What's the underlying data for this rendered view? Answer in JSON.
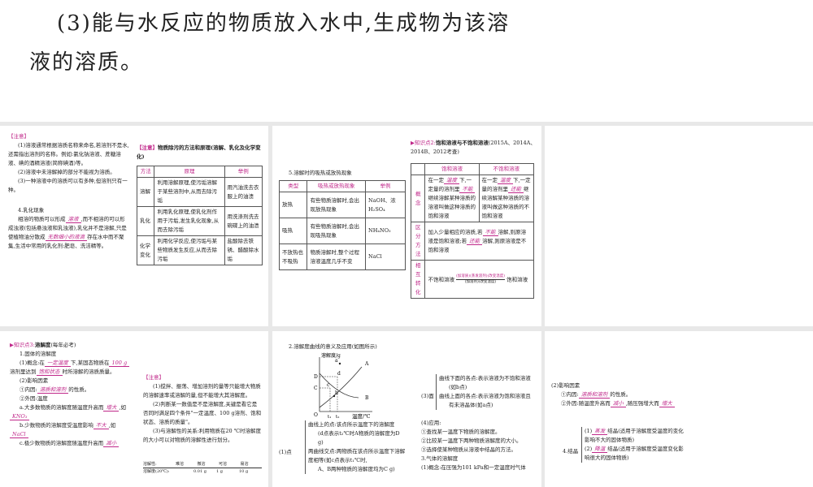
{
  "main_slide": {
    "line1": "(3)能与水反应的物质放入水中,生成物为该溶",
    "line2": "液的溶质。"
  },
  "slide1": {
    "note_title": "【注意】",
    "notes": [
      "(1)溶液通常根据溶质名称来命名,若溶剂不是水,还需指出溶剂的名称。例如:氯化钠溶液、蔗糖溶液、碘的酒精溶液(简称碘酒)等。",
      "(2)溶液中未溶解掉的部分不能视为溶质。",
      "(3)一种溶液中的溶质可以有多种,但溶剂只有一种。"
    ],
    "section4_title": "4.乳化现象",
    "s4_a": "相溶的物质可以形成",
    "s4_blank1": "溶液",
    "s4_b": ",而不相溶的可以形成浊液(包括悬浊液和乳浊液),乳化并不是溶解,只是使植物油分散成",
    "s4_blank2": "无数细小的液滴",
    "s4_c": "存在水中而不聚集,生活中常用的乳化剂:肥皂、洗洁精等。",
    "table_note": "【注意】",
    "table_title": "物质除污的方法和原理(溶解、乳化及化学变化)",
    "table_headers": [
      "方法",
      "原理",
      "举例"
    ],
    "table_rows": [
      [
        "溶解",
        "利用溶解原理,使污垢溶解于某些溶剂中,从而去除污垢",
        "用汽油洗去衣服上的油渍"
      ],
      [
        "乳化",
        "利用乳化原理,使乳化剂作用于污垢,发生乳化现象,从而去除污垢",
        "用洗涤剂洗去碗碟上的油渍"
      ],
      [
        "化学变化",
        "利用化学反应,使污垢与某些物质发生反应,从而去除污垢",
        "盐酸除去铁锈、醋酸除水垢"
      ]
    ]
  },
  "slide2": {
    "section5_title": "5.溶解时的吸热或放热现象",
    "heat_headers": [
      "类型",
      "吸热或放热现象",
      "举例"
    ],
    "heat_rows": [
      [
        "放热",
        "有些物质溶解时,会出现放热现象",
        "NaOH、浓H₂SO₄"
      ],
      [
        "吸热",
        "有些物质溶解时,会出现吸热现象",
        "NH₄NO₃"
      ],
      [
        "不放热也不吸热",
        "物质溶解时,整个过程溶液温度几乎不变",
        "NaCl"
      ]
    ],
    "kp2_label": "知识点2:",
    "kp2_title": "饱和溶液与不饱和溶液",
    "kp2_years": "(2015A、2014A、2014B、2012考查)",
    "sat_headers": [
      "",
      "饱和溶液",
      "不饱和溶液"
    ],
    "concept_label": "概念",
    "sat_concept": {
      "a": "在一定",
      "b1": "温度",
      "c": "下,一定量的溶剂里",
      "b2": "不能",
      "d": "继续溶解某种溶质的溶液叫做这种溶质的饱和溶液"
    },
    "unsat_concept": {
      "a": "在一定",
      "b1": "温度",
      "c": "下,一定量的溶剂里",
      "b2": "还能",
      "d": "继续溶解某种溶质的溶液叫做这种溶质的不饱和溶液"
    },
    "distinguish_label": "区分方法",
    "distinguish": {
      "a": "加入少量相应的溶质,若",
      "b1": "不能",
      "c": "溶解,则原溶液是饱和溶液;若",
      "b2": "还能",
      "d": "溶解,则原溶液是不饱和溶液"
    },
    "convert_label": "相互转化",
    "convert": {
      "a": "不饱和溶液",
      "top": "(加溶质)(蒸发溶剂)(改变温度)",
      "bottom": "(加溶剂)(改变温度)",
      "b": "饱和溶液"
    }
  },
  "slide4": {
    "kp3_label": "知识点3:",
    "kp3_title": "溶解度",
    "kp3_years": "(每年必考)",
    "h1": "1.固体的溶解度",
    "c_a": "(1)概念:在",
    "c_b1": "一定温度",
    "c_b": "下,某固态物质在",
    "c_b2": "100 g",
    "c_c": "溶剂里达到",
    "c_b3": "饱和状态",
    "c_d": "时所溶解的溶质质量。",
    "factors": "(2)影响因素",
    "inner_a": "①内因:",
    "inner_b": "溶质和溶剂",
    "inner_c": "的性质。",
    "outer": "②外因:温度",
    "a_a": "a.大多数物质的溶解度随温度升高而",
    "a_b": "增大",
    "a_c": ",如",
    "a_d": "KNO₃",
    "b_a": "b.少数物质的溶解度受温度影响",
    "b_b": "不大",
    "b_c": ",如",
    "b_d": "NaCl",
    "c2_a": "c.极少数物质的溶解度随温度升高而",
    "c2_b": "减小",
    "note_title": "【注意】",
    "notes": [
      "(1)搅拌、振荡、增加溶剂的量等只能增大物质的溶解速率或溶解的量,但不能增大其溶解度。",
      "(2)判断某一数值是不是溶解度,关键是看它是否同时满足四个条件\"一定温度、100 g溶剂、饱和状态、溶质的质量\"。",
      "(3)与溶解性的关系:利用物质在20 ℃时溶解度的大小可以对物质的溶解性进行划分。"
    ],
    "scale_label1": "溶解性:",
    "scale_label2": "溶解度(20℃):",
    "scale_classes": [
      "难溶",
      "微溶",
      "可溶",
      "易溶"
    ],
    "scale_ticks": [
      "0.01 g",
      "1 g",
      "10 g"
    ]
  },
  "slide5": {
    "h2": "2.溶解度曲线的意义及应用(如图所示)",
    "graph": {
      "ylabel": "溶解度/g",
      "xlabel": "温度/℃",
      "origin": "O",
      "D": "D",
      "C": "C",
      "A": "A",
      "B": "B",
      "a": "a",
      "b": "b",
      "c": "c",
      "d": "d",
      "t1": "t₁",
      "t2": "t₂"
    },
    "point_label": "(1)点",
    "point_items": [
      "曲线上的点:该点所示温度下的溶解度",
      "(d点表示t₂℃时A物质的溶解度为D g)",
      "两曲线交点:两物质在该点所示温度下溶解度相等(如c点表示t₁℃时,",
      "A、B两种物质的溶解度均为C g)"
    ],
    "area_label": "(3)面",
    "area_items": [
      "曲线下面的各点:表示溶液为不饱和溶液",
      "(如b点)",
      "曲线上面的各点:表示溶液为饱和溶液且",
      "有未溶晶体(如a点)"
    ],
    "apply_title": "(4)应用:",
    "apply_items": [
      "①查找某一温度下物质的溶解度。",
      "②比较某一温度下两种物质溶解度的大小。",
      "③选择使某种物质从溶液中结晶的方法。"
    ],
    "gas_title": "3.气体的溶解度",
    "gas_concept": "(1)概念:在压强为101 kPa和一定温度时气体"
  },
  "slide6": {
    "factors": "(2)影响因素",
    "inner_a": "①内因:",
    "inner_b": "溶质和溶剂",
    "inner_c": "的性质。",
    "outer_a": "②外因:随温度升高而",
    "outer_b": "减小",
    "outer_c": ",随压强增大而",
    "outer_d": "增大",
    "cryst_label": "4.结晶",
    "c1_a": "(1)",
    "c1_b": "蒸发",
    "c1_c": "结晶(适用于溶解度受温度的变化影响不大的固体物质)",
    "c2_a": "(2)",
    "c2_b": "降温",
    "c2_c": "结晶(适用于溶解度受温度变化影响很大的固体物质)"
  }
}
